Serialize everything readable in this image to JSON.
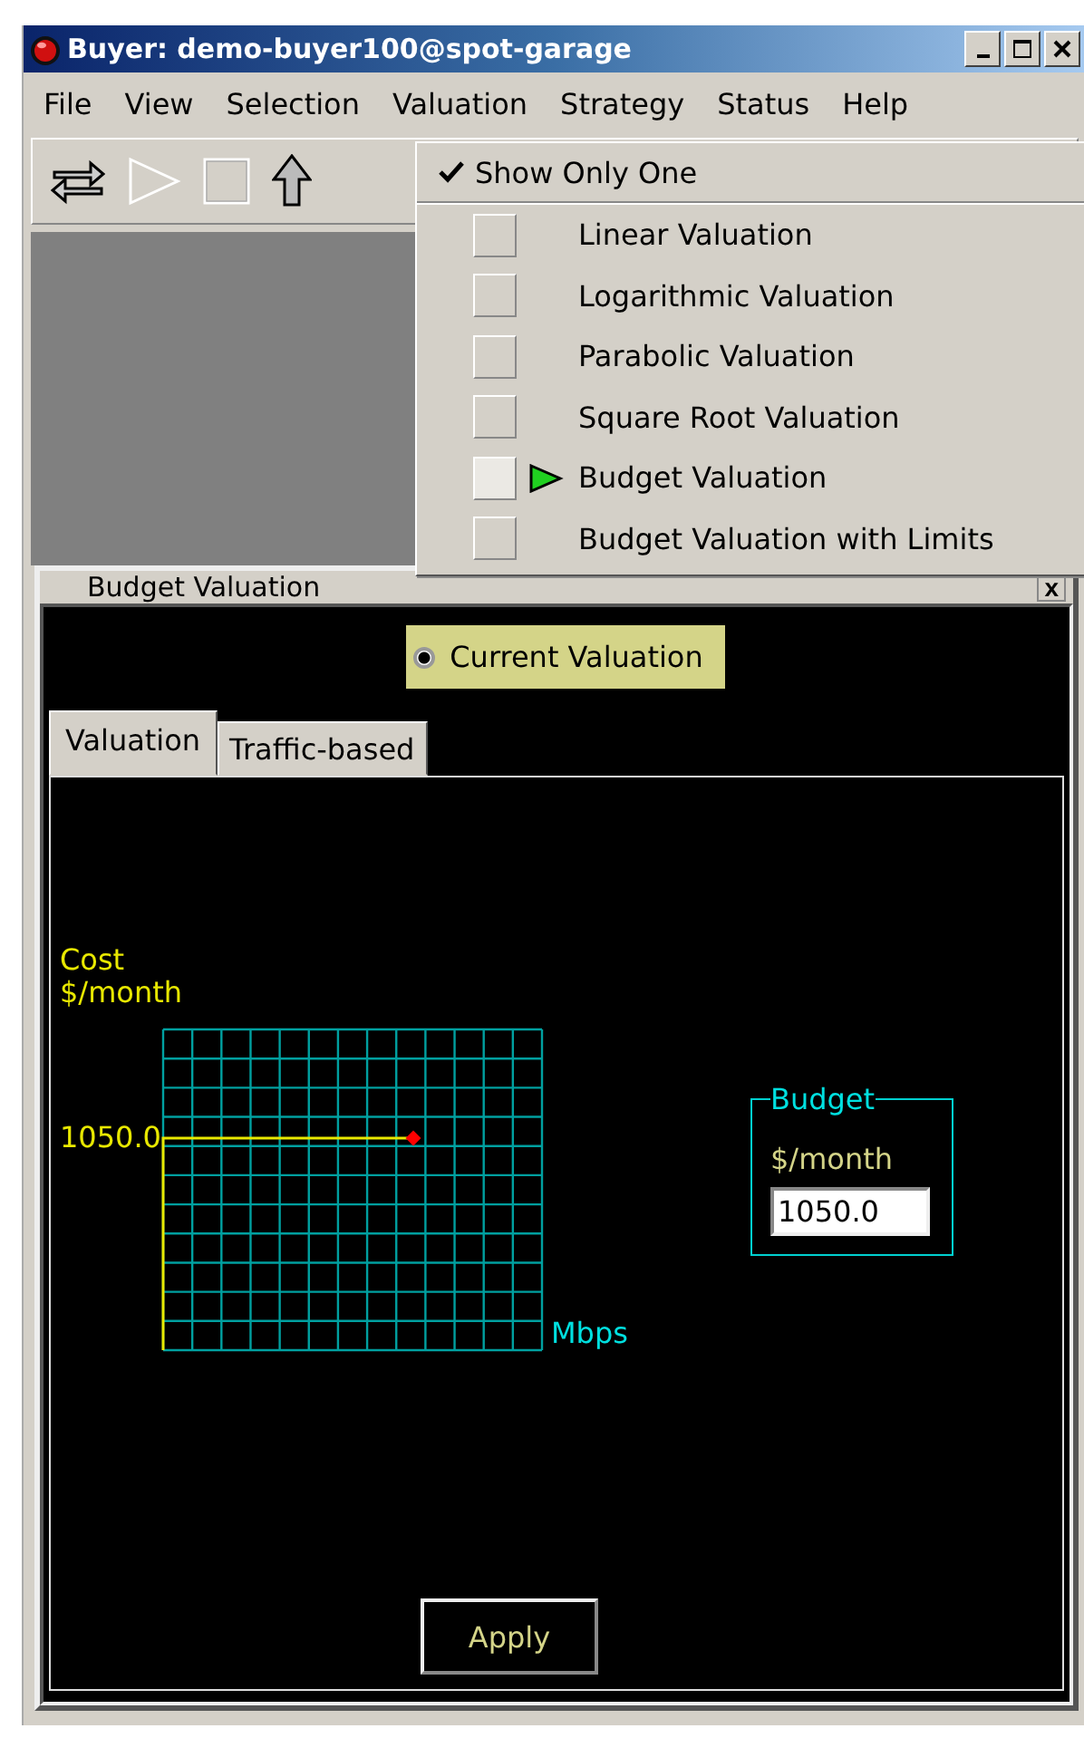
{
  "window": {
    "title": "Buyer: demo-buyer100@spot-garage"
  },
  "menu_bar": [
    "File",
    "View",
    "Selection",
    "Valuation",
    "Strategy",
    "Status",
    "Help"
  ],
  "valuation_menu": {
    "show_only_one": {
      "label": "Show Only One",
      "checked": true
    },
    "items": [
      {
        "label": "Linear Valuation",
        "selected": false
      },
      {
        "label": "Logarithmic Valuation",
        "selected": false
      },
      {
        "label": "Parabolic Valuation",
        "selected": false
      },
      {
        "label": "Square Root Valuation",
        "selected": false
      },
      {
        "label": "Budget Valuation",
        "selected": true
      },
      {
        "label": "Budget Valuation with Limits",
        "selected": false
      }
    ]
  },
  "internal_frame": {
    "title": "Budget Valuation",
    "close": "x",
    "radio": {
      "label": "Current Valuation",
      "selected": true
    },
    "tabs": [
      {
        "label": "Valuation",
        "selected": true
      },
      {
        "label": "Traffic-based",
        "selected": false
      }
    ],
    "graph": {
      "y_label_1": "Cost",
      "y_label_2": "$/month",
      "value_label": "1050.0",
      "x_label": "Mbps"
    },
    "budget": {
      "legend": "Budget",
      "label": "$/month",
      "value": "1050.0"
    },
    "apply_button": "Apply"
  }
}
